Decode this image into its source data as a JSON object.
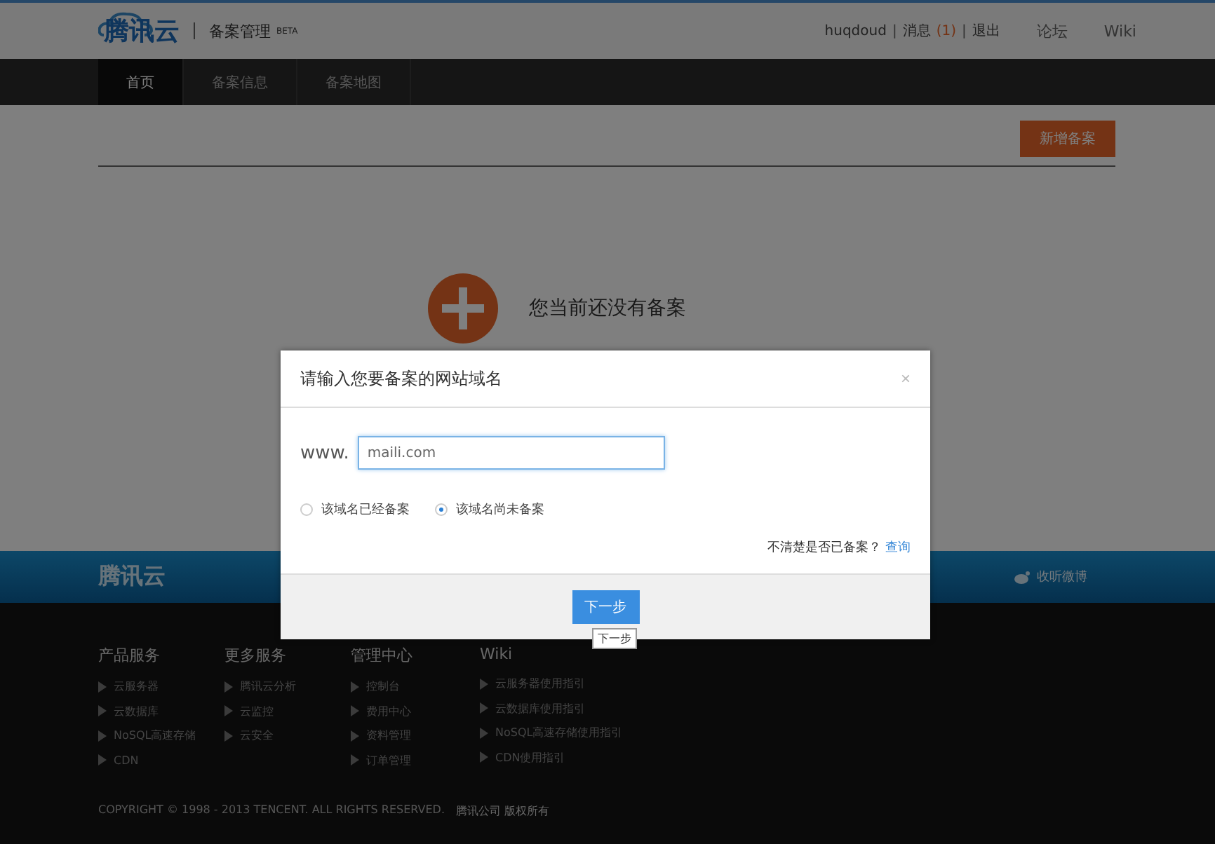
{
  "header": {
    "logo": "腾讯云",
    "separator": "|",
    "product": "备案管理",
    "badge": "BETA",
    "user": "huqdoud",
    "messages_label": "消息",
    "messages_count": "(1)",
    "logout": "退出",
    "links": [
      "论坛",
      "Wiki"
    ]
  },
  "nav": [
    {
      "label": "首页",
      "selected": true
    },
    {
      "label": "备案信息",
      "selected": false
    },
    {
      "label": "备案地图",
      "selected": false
    }
  ],
  "add_button": "新增备案",
  "empty_message": "您当前还没有备案",
  "dialog": {
    "title": "请输入您要备案的网站域名",
    "close": "×",
    "prefix": "www.",
    "value": "maili.com",
    "options": [
      {
        "label": "该域名已经备案",
        "selected": false
      },
      {
        "label": "该域名尚未备案",
        "selected": true
      }
    ],
    "hint": "不清楚是否已备案？",
    "hint_link": "查询",
    "next": "下一步",
    "tooltip": "下一步"
  },
  "footer": {
    "logo": "腾讯云",
    "weibo": "收听微博",
    "columns": [
      {
        "title": "产品服务",
        "items": [
          "云服务器",
          "云数据库",
          "NoSQL高速存储",
          "CDN"
        ]
      },
      {
        "title": "更多服务",
        "items": [
          "腾讯云分析",
          "云监控",
          "云安全"
        ]
      },
      {
        "title": "管理中心",
        "items": [
          "控制台",
          "费用中心",
          "资料管理",
          "订单管理"
        ]
      },
      {
        "title": "Wiki",
        "items": [
          "云服务器使用指引",
          "云数据库使用指引",
          "NoSQL高速存储使用指引",
          "CDN使用指引"
        ]
      }
    ],
    "copyright": "COPYRIGHT © 1998 - 2013 TENCENT. ALL RIGHTS RESERVED.",
    "company": "腾讯公司 版权所有"
  }
}
